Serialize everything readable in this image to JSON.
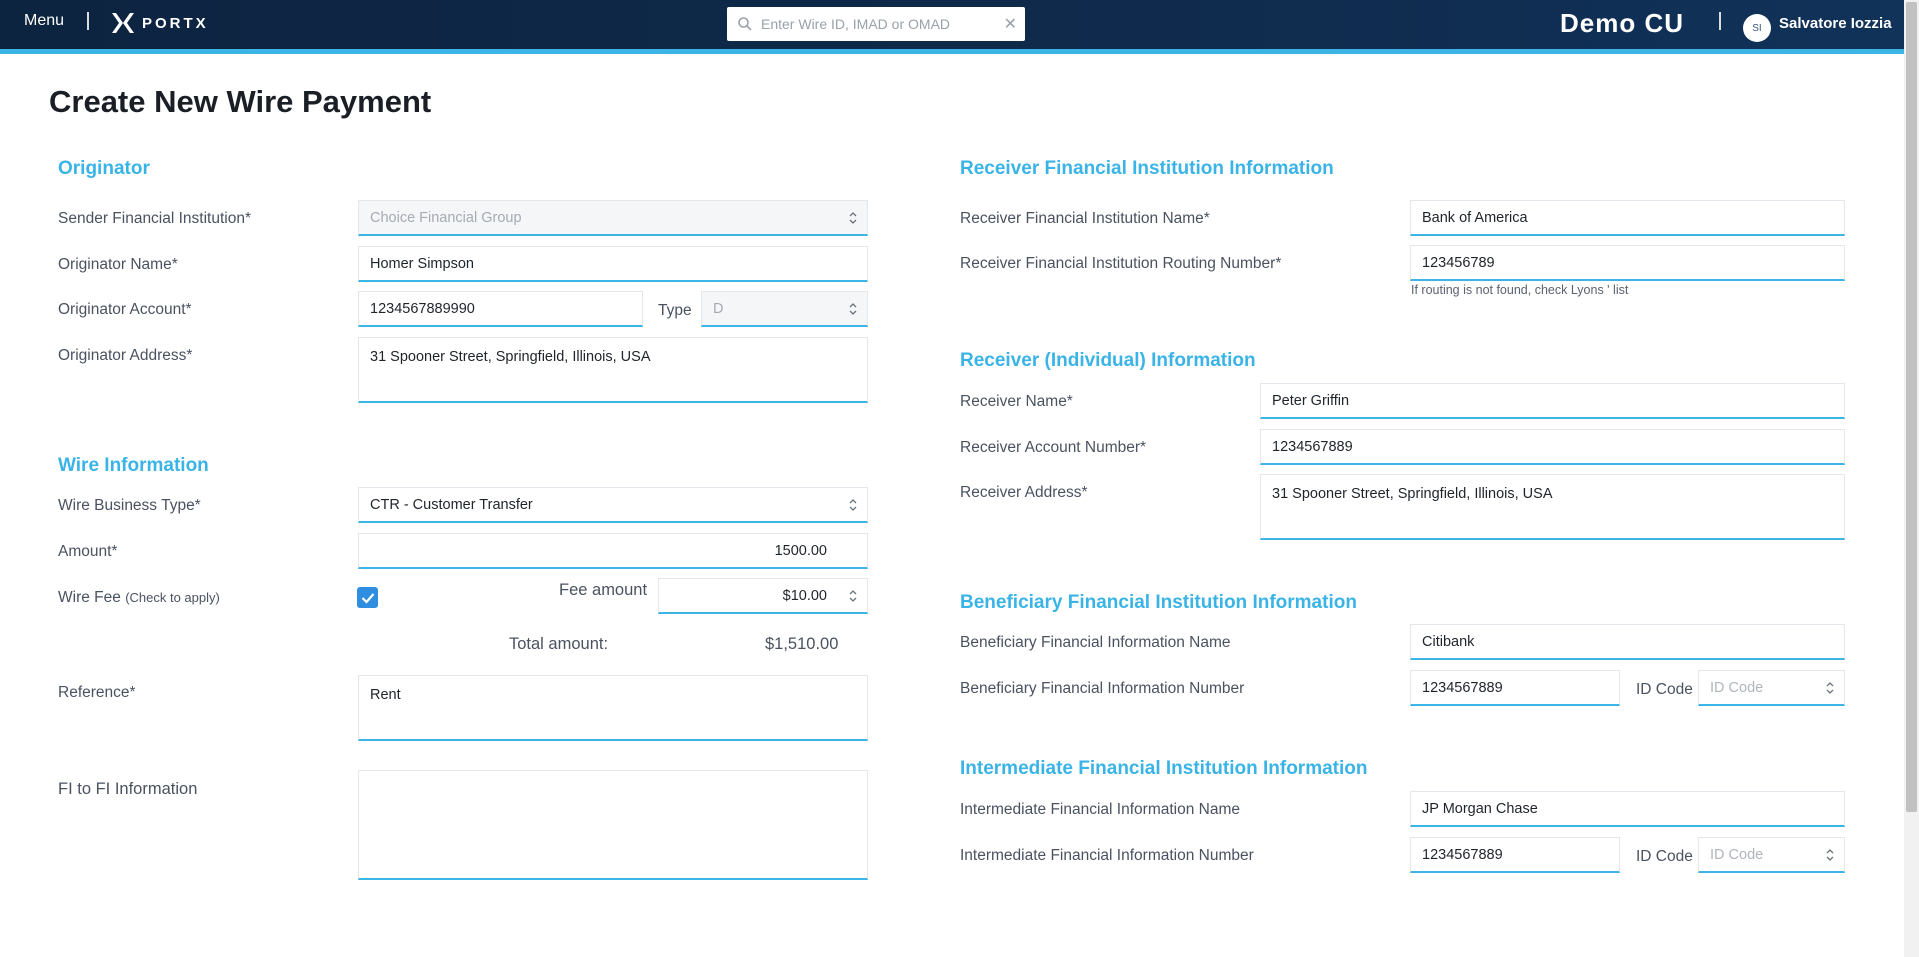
{
  "topbar": {
    "menu_label": "Menu",
    "logo_text": "PORTX",
    "search_placeholder": "Enter Wire ID, IMAD or OMAD",
    "org_name": "Demo CU",
    "user_initials": "SI",
    "user_name": "Salvatore Iozzia",
    "colors": {
      "bar": "#0f2a4c",
      "accent": "#3cb5e6"
    }
  },
  "page_title": "Create New Wire Payment",
  "originator": {
    "section_title": "Originator",
    "sender_fi_label": "Sender Financial Institution*",
    "sender_fi_value": "Choice Financial Group",
    "name_label": "Originator Name*",
    "name_value": "Homer Simpson",
    "account_label": "Originator Account*",
    "account_value": "1234567889990",
    "type_label": "Type",
    "type_value": "D",
    "address_label": "Originator Address*",
    "address_value": "31 Spooner Street, Springfield, Illinois, USA"
  },
  "wire": {
    "section_title": "Wire Information",
    "business_type_label": "Wire Business Type*",
    "business_type_value": "CTR - Customer Transfer",
    "amount_label": "Amount*",
    "amount_value": "1500.00",
    "fee_label": "Wire Fee",
    "fee_hint": "(Check to apply)",
    "fee_checked": true,
    "fee_amount_label": "Fee amount",
    "fee_amount_value": "$10.00",
    "total_label": "Total amount:",
    "total_value": "$1,510.00",
    "reference_label": "Reference*",
    "reference_value": "Rent",
    "fi_to_fi_label": "FI to FI Information",
    "fi_to_fi_value": ""
  },
  "receiver_fi": {
    "section_title": "Receiver Financial Institution Information",
    "name_label": "Receiver Financial Institution Name*",
    "name_value": "Bank of America",
    "routing_label": "Receiver Financial Institution Routing Number*",
    "routing_value": "123456789",
    "routing_hint": "If routing is not found, check Lyons ' list"
  },
  "receiver": {
    "section_title": "Receiver (Individual) Information",
    "name_label": "Receiver Name*",
    "name_value": "Peter Griffin",
    "account_label": "Receiver Account Number*",
    "account_value": "1234567889",
    "address_label": "Receiver Address*",
    "address_value": "31 Spooner Street, Springfield, Illinois, USA"
  },
  "beneficiary_fi": {
    "section_title": "Beneficiary Financial Institution Information",
    "name_label": "Beneficiary Financial Information Name",
    "name_value": "Citibank",
    "number_label": "Beneficiary Financial Information Number",
    "number_value": "1234567889",
    "id_code_label": "ID Code",
    "id_code_placeholder": "ID Code"
  },
  "intermediate_fi": {
    "section_title": "Intermediate Financial Institution Information",
    "name_label": "Intermediate Financial Information Name",
    "name_value": "JP Morgan Chase",
    "number_label": "Intermediate Financial Information Number",
    "number_value": "1234567889",
    "id_code_label": "ID Code",
    "id_code_placeholder": "ID Code"
  }
}
